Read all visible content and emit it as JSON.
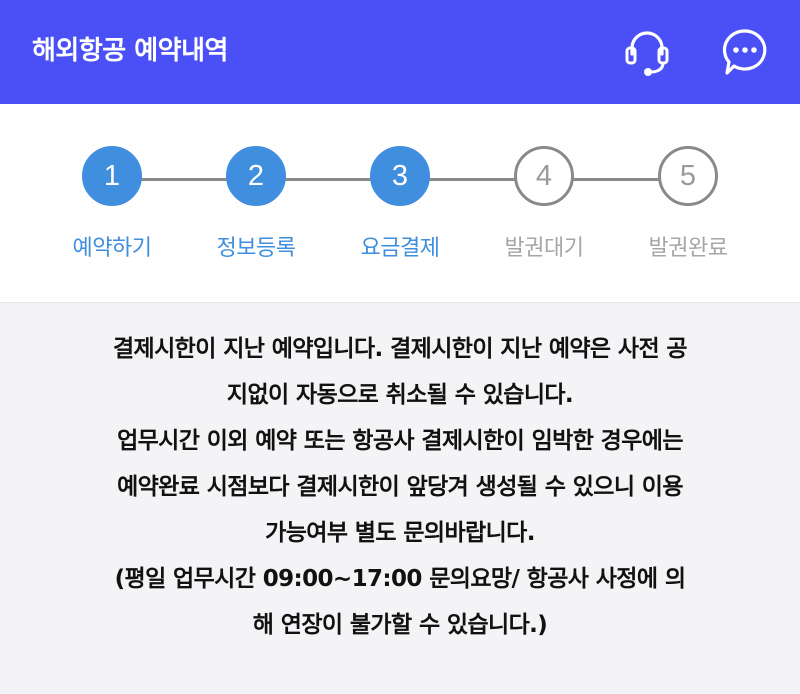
{
  "header": {
    "title": "해외항공 예약내역",
    "icons": {
      "support": "headset-icon",
      "chat": "chat-bubble-icon"
    },
    "background_color": "#4a50f5"
  },
  "steps": [
    {
      "number": "1",
      "label": "예약하기",
      "state": "done"
    },
    {
      "number": "2",
      "label": "정보등록",
      "state": "done"
    },
    {
      "number": "3",
      "label": "요금결제",
      "state": "done"
    },
    {
      "number": "4",
      "label": "발권대기",
      "state": "todo"
    },
    {
      "number": "5",
      "label": "발권완료",
      "state": "todo"
    }
  ],
  "colors": {
    "active": "#3f8fde",
    "inactive": "#a6a6a6"
  },
  "notice": {
    "lines": [
      "결제시한이 지난 예약입니다. 결제시한이 지난 예약은 사전 공",
      "지없이 자동으로 취소될 수 있습니다.",
      "업무시간 이외 예약 또는 항공사 결제시한이 임박한 경우에는",
      "예약완료 시점보다 결제시한이 앞당겨 생성될 수 있으니 이용",
      "가능여부 별도 문의바랍니다.",
      "(평일 업무시간 09:00~17:00 문의요망/ 항공사 사정에 의",
      "해 연장이 불가할 수 있습니다.)"
    ]
  }
}
